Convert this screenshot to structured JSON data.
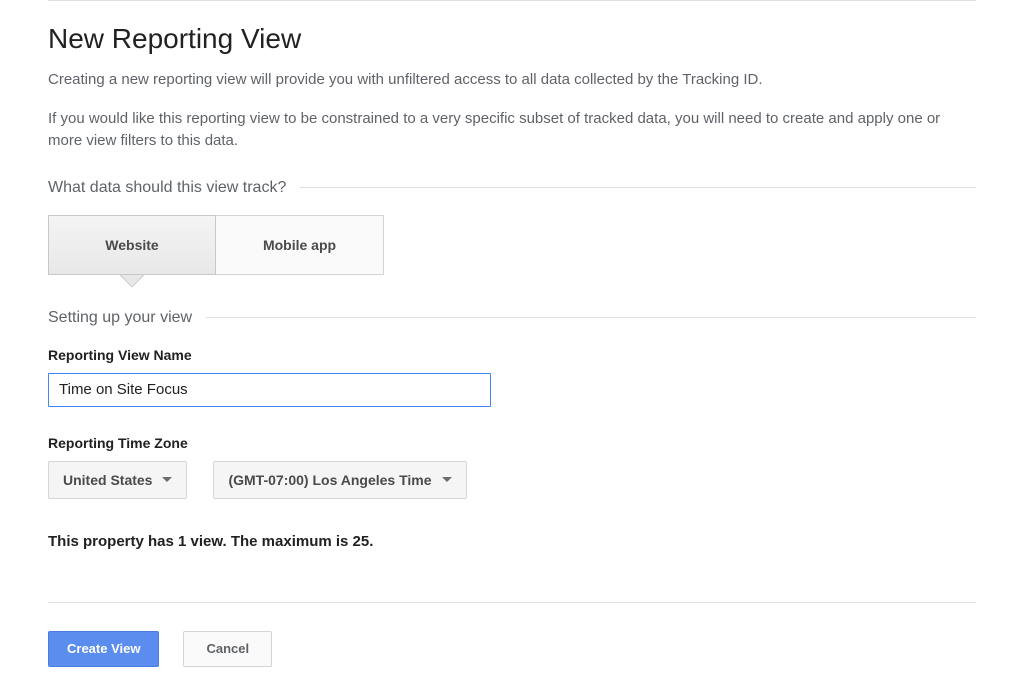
{
  "page": {
    "title": "New Reporting View",
    "intro1": "Creating a new reporting view will provide you with unfiltered access to all data collected by the Tracking ID.",
    "intro2": "If you would like this reporting view to be constrained to a very specific subset of tracked data, you will need to create and apply one or more view filters to this data."
  },
  "trackSection": {
    "heading": "What data should this view track?",
    "options": {
      "website": "Website",
      "mobile": "Mobile app"
    },
    "selected": "website"
  },
  "setupSection": {
    "heading": "Setting up your view",
    "viewNameLabel": "Reporting View Name",
    "viewNameValue": "Time on Site Focus",
    "timeZoneLabel": "Reporting Time Zone",
    "countrySelected": "United States",
    "tzSelected": "(GMT-07:00) Los Angeles Time",
    "viewCountNotice": "This property has 1 view. The maximum is 25."
  },
  "actions": {
    "create": "Create View",
    "cancel": "Cancel"
  }
}
